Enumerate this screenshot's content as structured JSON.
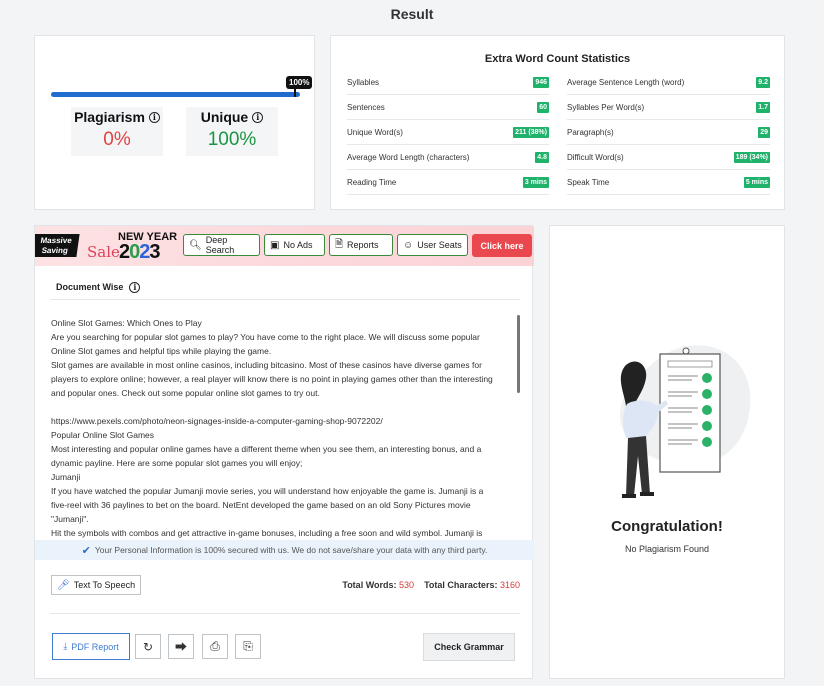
{
  "page_title": "Result",
  "result": {
    "progress_percent": 100,
    "progress_label": "100%",
    "plagiarism_label": "Plagiarism",
    "plagiarism_value": "0%",
    "unique_label": "Unique",
    "unique_value": "100%"
  },
  "stats": {
    "title": "Extra Word Count Statistics",
    "left": [
      {
        "label": "Syllables",
        "value": "946"
      },
      {
        "label": "Sentences",
        "value": "60"
      },
      {
        "label": "Unique Word(s)",
        "value": "211 (38%)"
      },
      {
        "label": "Average Word Length (characters)",
        "value": "4.8"
      },
      {
        "label": "Reading Time",
        "value": "3 mins"
      }
    ],
    "right": [
      {
        "label": "Average Sentence Length (word)",
        "value": "9.2"
      },
      {
        "label": "Syllables Per Word(s)",
        "value": "1.7"
      },
      {
        "label": "Paragraph(s)",
        "value": "29"
      },
      {
        "label": "Difficult Word(s)",
        "value": "189 (34%)"
      },
      {
        "label": "Speak Time",
        "value": "5 mins"
      }
    ]
  },
  "banner": {
    "massive_line1": "Massive",
    "massive_line2": "Saving",
    "new_year": "NEW YEAR",
    "sale": "Sale",
    "year_digits": [
      "2",
      "0",
      "2",
      "3"
    ],
    "deep_search": "Deep Search",
    "no_ads": "No Ads",
    "reports": "Reports",
    "user_seats": "User Seats",
    "click_here": "Click here"
  },
  "document": {
    "header": "Document Wise",
    "lines": [
      "Online Slot Games: Which Ones to Play",
      "Are you searching for popular slot games to play? You have come to the right place. We will discuss some popular",
      "Online Slot games and helpful tips while playing the game.",
      "Slot games are available in most online casinos, including bitcasino. Most of these casinos have diverse games for",
      "players to explore online; however, a real player will know there is no point in playing games other than the interesting",
      "and popular ones. Check out some popular online slot games to try out.",
      "",
      "https://www.pexels.com/photo/neon-signages-inside-a-computer-gaming-shop-9072202/",
      "Popular Online Slot Games",
      "Most interesting and popular online games have a different theme when you see them, an interesting bonus, and a",
      "dynamic payline. Here are some popular slot games you will enjoy;",
      "Jumanji",
      "If you have watched the popular Jumanji movie series, you will understand how enjoyable the game is. Jumanji is a",
      "five-reel with 36 paylines to bet on the board. NetEnt developed the game based on an old Sony Pictures movie",
      "\"Jumanji\".",
      "Hit the symbols with combos and get attractive in-game bonuses, including a free soon and wild symbol. Jumanji is"
    ],
    "secure_note": "Your Personal Information is 100% secured with us. We do not save/share your data with any third party.",
    "tts_label": "Text To Speech",
    "total_words_label": "Total Words:",
    "total_words": "530",
    "total_chars_label": "Total Characters:",
    "total_chars": "3160",
    "pdf_report": "PDF Report",
    "check_grammar": "Check Grammar"
  },
  "congrats": {
    "title": "Congratulation!",
    "subtitle": "No Plagiarism Found"
  },
  "colors": {
    "accent_blue": "#1f6bd0",
    "plagiarism_red": "#e14343",
    "unique_green": "#1c9443",
    "badge_green": "#1fb26b",
    "click_red": "#e8484e"
  }
}
